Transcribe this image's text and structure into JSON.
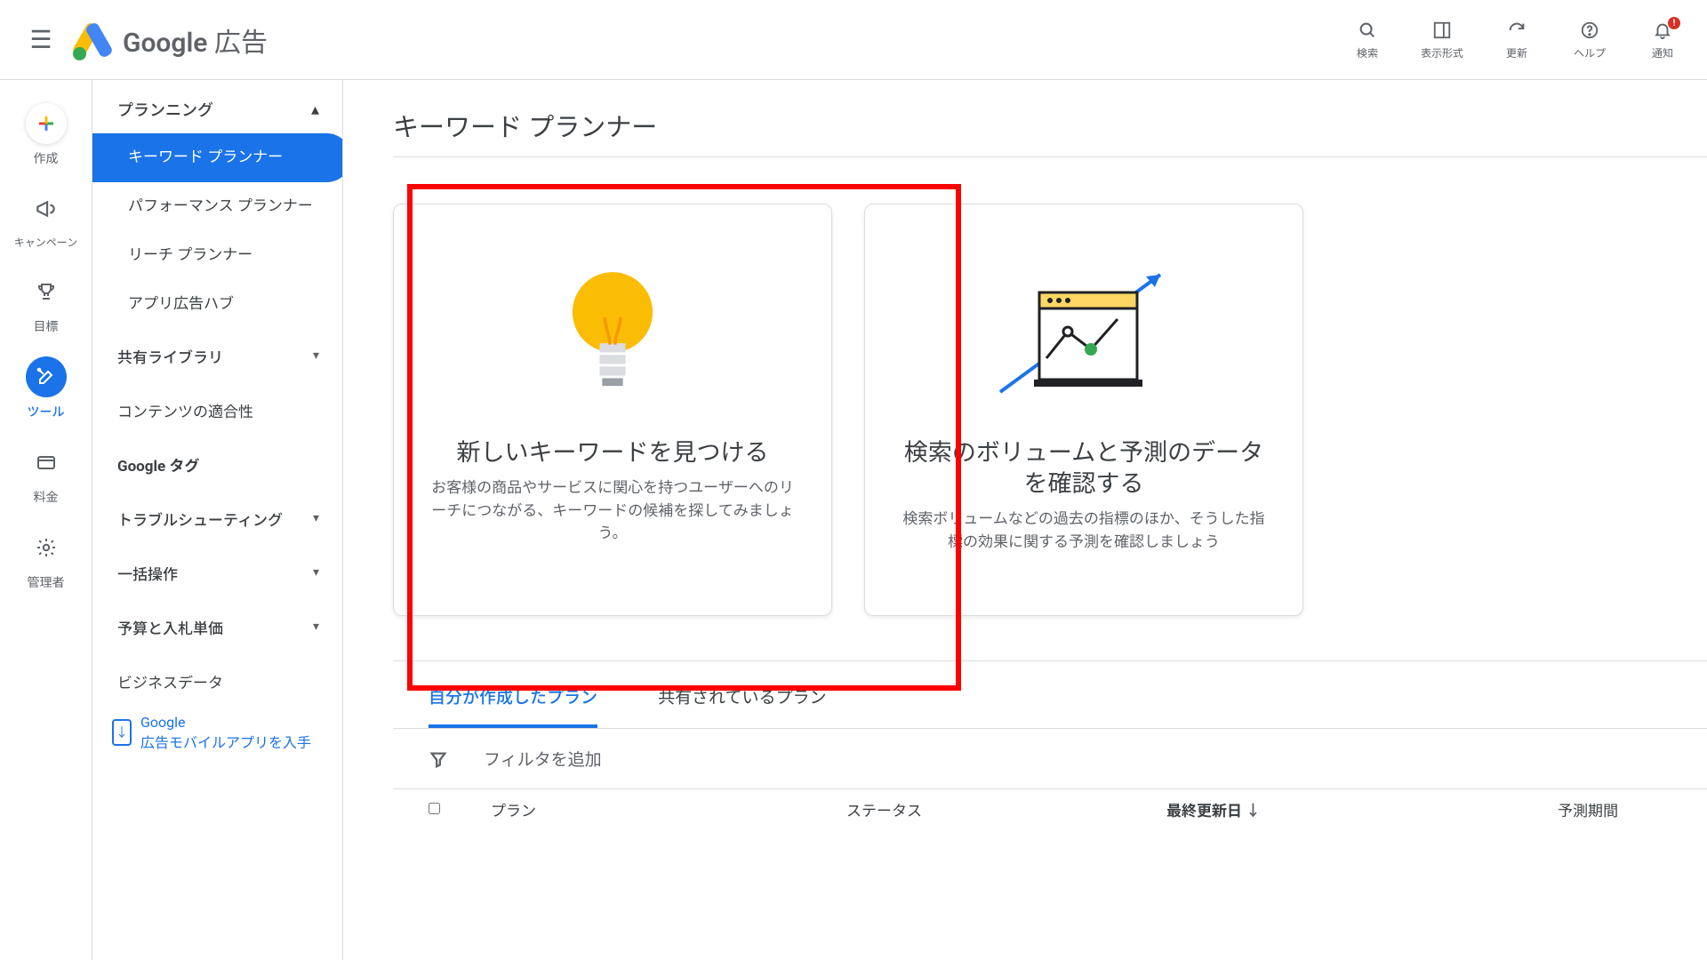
{
  "brand": {
    "google": "Google",
    "product": "広告"
  },
  "header": {
    "search": "検索",
    "layout": "表示形式",
    "refresh": "更新",
    "help": "ヘルプ",
    "notifications": "通知",
    "notif_badge": "!"
  },
  "rail": {
    "create": "作成",
    "campaigns": "キャンペーン",
    "goals": "目標",
    "tools": "ツール",
    "billing": "料金",
    "admin": "管理者"
  },
  "sidepanel": {
    "planning": "プランニング",
    "items": {
      "keyword_planner": "キーワード プランナー",
      "performance_planner": "パフォーマンス プランナー",
      "reach_planner": "リーチ プランナー",
      "app_hub": "アプリ広告ハブ"
    },
    "shared_library": "共有ライブラリ",
    "content_suitability": "コンテンツの適合性",
    "google_tag": "Google タグ",
    "troubleshooting": "トラブルシューティング",
    "bulk_actions": "一括操作",
    "budgets_bids": "予算と入札単価",
    "business_data": "ビジネスデータ",
    "mobile_app_line1": "Google",
    "mobile_app_line2": "広告モバイルアプリを入手"
  },
  "main": {
    "title": "キーワード プランナー",
    "card1": {
      "title": "新しいキーワードを見つける",
      "desc": "お客様の商品やサービスに関心を持つユーザーへのリーチにつながる、キーワードの候補を探してみましょう。"
    },
    "card2": {
      "title": "検索のボリュームと予測のデータを確認する",
      "desc": "検索ボリュームなどの過去の指標のほか、そうした指標の効果に関する予測を確認しましょう"
    },
    "tabs": {
      "mine": "自分が作成したプラン",
      "shared": "共有されているプラン"
    },
    "filter_label": "フィルタを追加",
    "columns": {
      "plan": "プラン",
      "status": "ステータス",
      "last_updated": "最終更新日",
      "forecast_period": "予測期間"
    }
  }
}
